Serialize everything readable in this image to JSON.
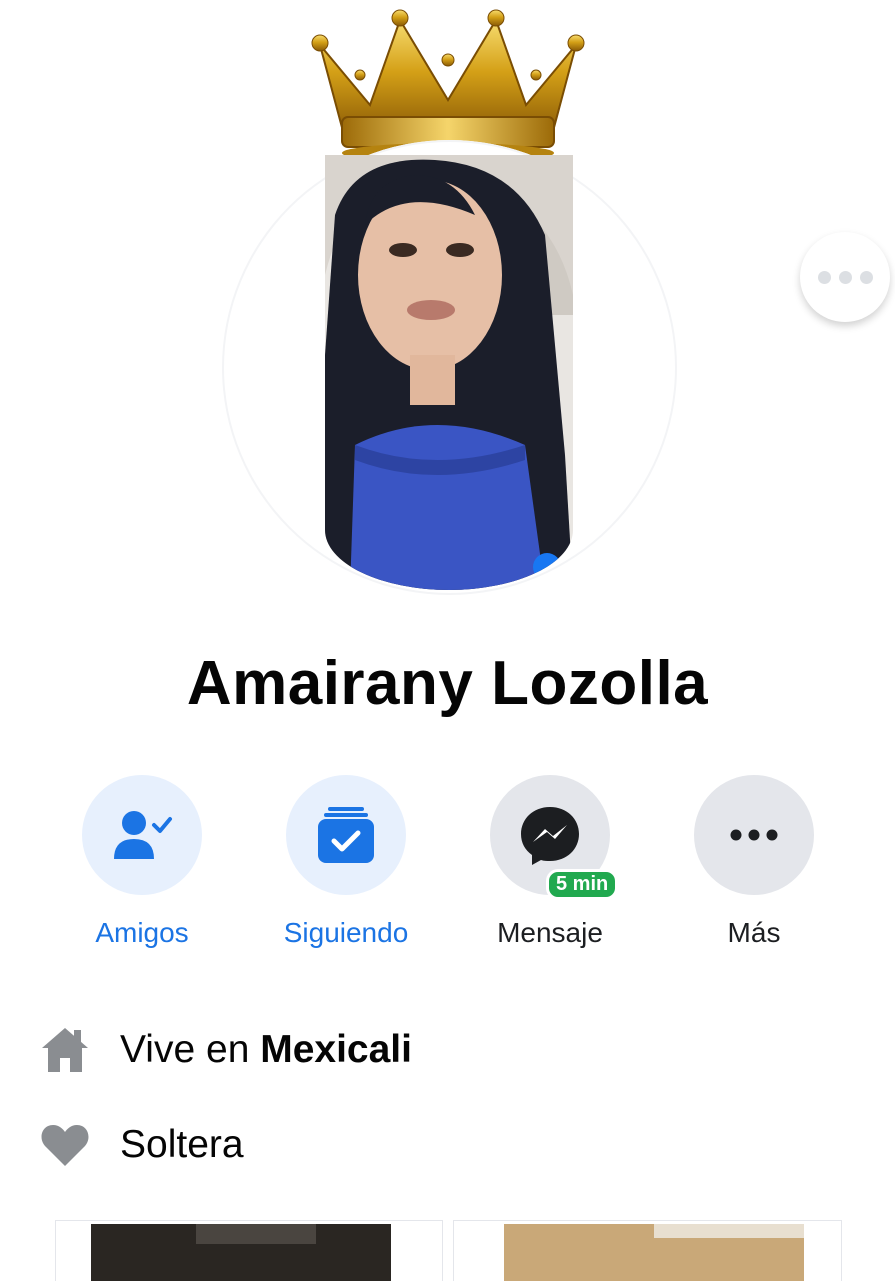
{
  "profile": {
    "name": "Amairany Lozolla"
  },
  "actions": [
    {
      "label": "Amigos",
      "icon": "friends-check-icon",
      "color": "#1b74e4"
    },
    {
      "label": "Siguiendo",
      "icon": "following-icon",
      "color": "#1b74e4"
    },
    {
      "label": "Mensaje",
      "icon": "messenger-icon",
      "color": "#1c1e21",
      "badge": "5 min"
    },
    {
      "label": "Más",
      "icon": "more-dots-icon",
      "color": "#1c1e21"
    }
  ],
  "intro": {
    "lives_prefix": "Vive en ",
    "lives_city": "Mexicali",
    "relationship": "Soltera"
  },
  "colors": {
    "accent_blue": "#1b74e4",
    "light_blue_bg": "#e7f0fd",
    "grey_bg": "#e4e6eb",
    "online_green": "#21a94f",
    "icon_grey": "#8a8d91"
  }
}
